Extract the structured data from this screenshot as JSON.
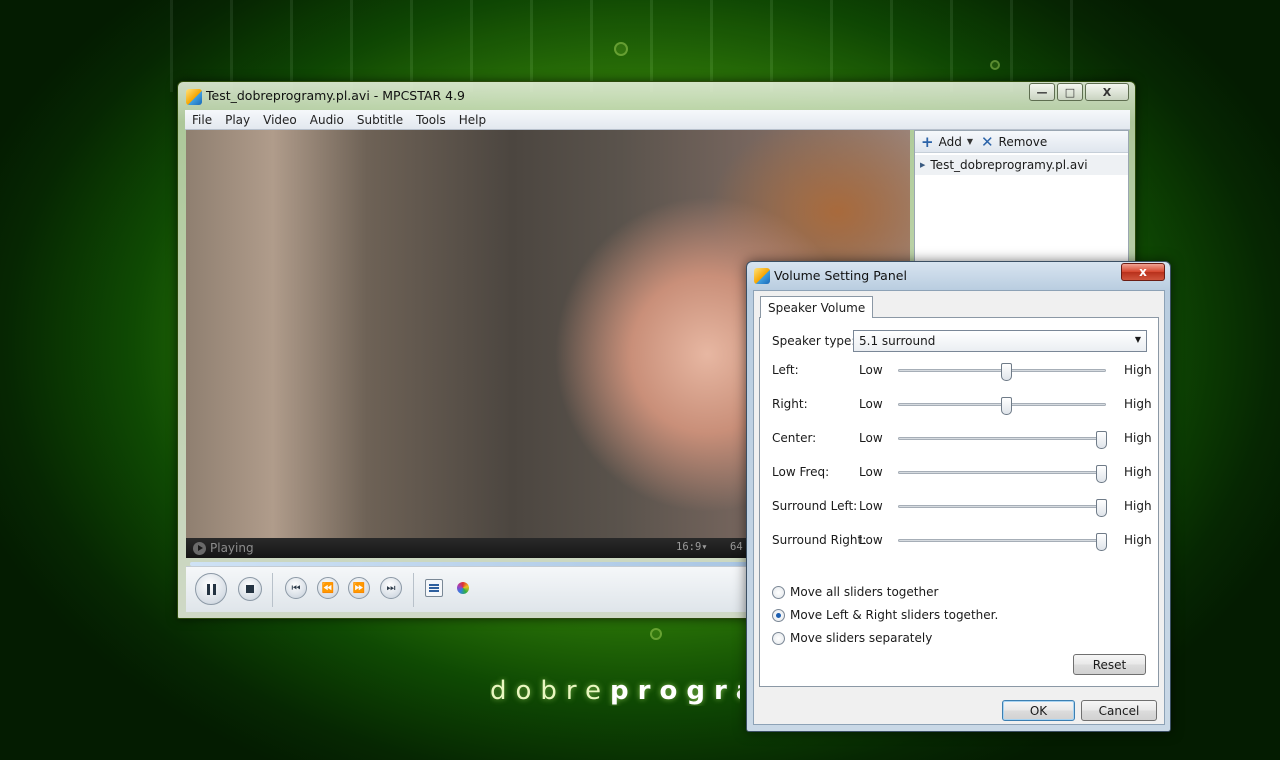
{
  "desktop": {
    "brand_light": "dobre",
    "brand_bold": "progra"
  },
  "player": {
    "title": "Test_dobreprogramy.pl.avi - MPCSTAR 4.9",
    "caption": {
      "minimize": "—",
      "maximize": "□",
      "close": "X"
    },
    "menu": [
      "File",
      "Play",
      "Video",
      "Audio",
      "Subtitle",
      "Tools",
      "Help"
    ],
    "status": {
      "state": "Playing",
      "aspect": "16:9▾",
      "time": "64"
    },
    "controls": {
      "pause_icon": "pause-icon",
      "stop_icon": "stop-icon",
      "prev_glyph": "⏮",
      "rewind_glyph": "⏪",
      "forward_glyph": "⏩",
      "next_glyph": "⏭"
    },
    "playlist": {
      "add_glyph": "+",
      "add_label": "Add",
      "remove_glyph": "✕",
      "remove_label": "Remove",
      "items": [
        "Test_dobreprogramy.pl.avi"
      ]
    }
  },
  "volume_panel": {
    "title": "Volume Setting Panel",
    "close_label": "x",
    "tab": "Speaker Volume",
    "speaker_type_label": "Speaker type:",
    "speaker_type_value": "5.1 surround",
    "low_label": "Low",
    "high_label": "High",
    "sliders": [
      {
        "name": "Left:",
        "level": 0.52
      },
      {
        "name": "Right:",
        "level": 0.52
      },
      {
        "name": "Center:",
        "level": 0.98
      },
      {
        "name": "Low Freq:",
        "level": 0.98
      },
      {
        "name": "Surround Left:",
        "level": 0.98
      },
      {
        "name": "Surround Right:",
        "level": 0.98
      }
    ],
    "radios": [
      {
        "label": "Move all sliders together",
        "checked": false
      },
      {
        "label": "Move Left & Right sliders together.",
        "checked": true
      },
      {
        "label": "Move sliders separately",
        "checked": false
      }
    ],
    "reset_label": "Reset",
    "ok_label": "OK",
    "cancel_label": "Cancel"
  }
}
